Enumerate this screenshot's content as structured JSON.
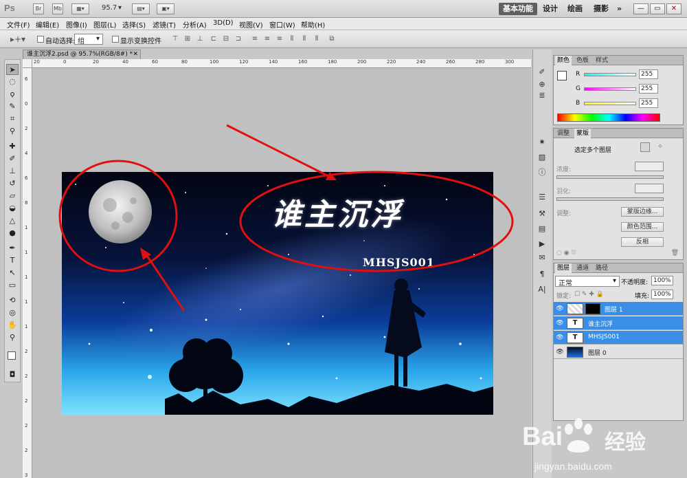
{
  "app": {
    "logo": "Ps",
    "zoom": "95.7",
    "title_buttons": [
      "Br",
      "Mb"
    ],
    "workspaces": [
      "基本功能",
      "设计",
      "绘画",
      "摄影",
      "»"
    ],
    "window_controls": [
      "—",
      "▭",
      "✕"
    ]
  },
  "menu": [
    "文件(F)",
    "编辑(E)",
    "图像(I)",
    "图层(L)",
    "选择(S)",
    "滤镜(T)",
    "分析(A)",
    "3D(D)",
    "视图(V)",
    "窗口(W)",
    "帮助(H)"
  ],
  "options": {
    "auto_select_label": "自动选择:",
    "auto_select_value": "组",
    "transform_label": "显示变换控件"
  },
  "document": {
    "tab_title": "谁主沉浮2.psd @ 95.7%(RGB/8#) *",
    "close": "✕",
    "ruler_h": [
      "20",
      "0",
      "20",
      "40",
      "60",
      "80",
      "100",
      "120",
      "140",
      "160",
      "180",
      "200",
      "220",
      "240",
      "260",
      "280",
      "300"
    ],
    "ruler_v": [
      "6",
      "0",
      "2",
      "4",
      "6",
      "8",
      "1",
      "1",
      "1",
      "1",
      "1",
      "2",
      "2",
      "2",
      "2",
      "2",
      "3"
    ],
    "canvas_title": "谁主沉浮",
    "canvas_subtitle": "MHSJS001"
  },
  "color_panel": {
    "tabs": [
      "颜色",
      "色板",
      "样式"
    ],
    "channels": [
      {
        "label": "R",
        "value": "255"
      },
      {
        "label": "G",
        "value": "255"
      },
      {
        "label": "B",
        "value": "255"
      }
    ]
  },
  "mask_panel": {
    "tabs": [
      "调整",
      "蒙版"
    ],
    "header": "选定多个图层",
    "density": "浓度:",
    "feather": "羽化:",
    "refine": "调整:",
    "buttons": [
      "蒙版边缘...",
      "颜色范围...",
      "反相"
    ]
  },
  "layers_panel": {
    "tabs": [
      "图层",
      "通道",
      "路径"
    ],
    "blend_mode": "正常",
    "opacity_label": "不透明度:",
    "opacity_value": "100%",
    "lock_label": "锁定:",
    "fill_label": "填充:",
    "fill_value": "100%",
    "layers": [
      {
        "name": "图层 1",
        "kind": "image"
      },
      {
        "name": "谁主沉浮",
        "kind": "text",
        "glyph": "T"
      },
      {
        "name": "MHSJS001",
        "kind": "text",
        "glyph": "T"
      },
      {
        "name": "图层 0",
        "kind": "image"
      }
    ]
  },
  "watermark": {
    "brand_a": "Bai",
    "brand_b": "经验",
    "url": "jingyan.baidu.com"
  }
}
